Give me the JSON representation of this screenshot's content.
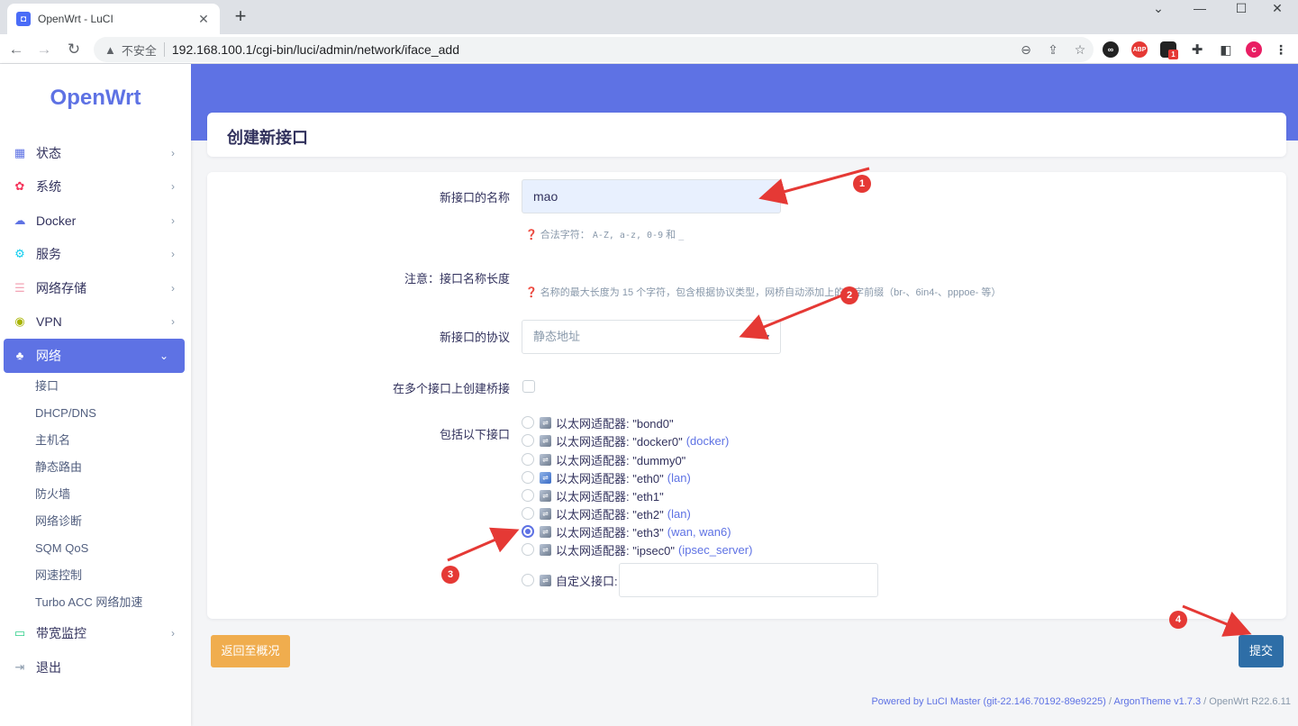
{
  "browser": {
    "tab_title": "OpenWrt - LuCI",
    "tab_close": "✕",
    "new_tab": "+",
    "not_secure": "不安全",
    "url": "192.168.100.1/cgi-bin/luci/admin/network/iface_add",
    "profile_initial": "c",
    "ext_badge": "1",
    "ext_abp": "ABP"
  },
  "sidebar": {
    "logo": "OpenWrt",
    "menu": [
      {
        "label": "状态",
        "icon": "dashboard-icon"
      },
      {
        "label": "系统",
        "icon": "gear-icon"
      },
      {
        "label": "Docker",
        "icon": "docker-icon"
      },
      {
        "label": "服务",
        "icon": "services-icon"
      },
      {
        "label": "网络存储",
        "icon": "storage-icon"
      },
      {
        "label": "VPN",
        "icon": "vpn-icon"
      },
      {
        "label": "网络",
        "icon": "network-icon"
      }
    ],
    "network_sub": [
      "接口",
      "DHCP/DNS",
      "主机名",
      "静态路由",
      "防火墙",
      "网络诊断",
      "SQM QoS",
      "网速控制",
      "Turbo ACC 网络加速"
    ],
    "after": [
      {
        "label": "带宽监控",
        "icon": "monitor-icon"
      },
      {
        "label": "退出",
        "icon": "logout-icon"
      }
    ]
  },
  "page": {
    "title": "创建新接口"
  },
  "form": {
    "name_label": "新接口的名称",
    "name_value": "mao",
    "name_hint_prefix": "合法字符：",
    "name_hint_chars": "A-Z, a-z, 0-9",
    "name_hint_and": "和",
    "name_hint_underscore": "_",
    "note_label": "注意：接口名称长度",
    "note_hint": "名称的最大长度为 15 个字符，包含根据协议类型，网桥自动添加上的名字前缀（br-、6in4-、pppoe- 等）",
    "protocol_label": "新接口的协议",
    "protocol_value": "静态地址",
    "bridge_label": "在多个接口上创建桥接",
    "include_label": "包括以下接口",
    "interfaces": [
      {
        "text": "以太网适配器: \"bond0\"",
        "zone": ""
      },
      {
        "text": "以太网适配器: \"docker0\"",
        "zone": "(docker)"
      },
      {
        "text": "以太网适配器: \"dummy0\"",
        "zone": ""
      },
      {
        "text": "以太网适配器: \"eth0\"",
        "zone": "(lan)"
      },
      {
        "text": "以太网适配器: \"eth1\"",
        "zone": ""
      },
      {
        "text": "以太网适配器: \"eth2\"",
        "zone": "(lan)"
      },
      {
        "text": "以太网适配器: \"eth3\"",
        "zone": "(wan, wan6)"
      },
      {
        "text": "以太网适配器: \"ipsec0\"",
        "zone": "(ipsec_server)"
      }
    ],
    "selected_interface": "eth3",
    "custom_label": "自定义接口:",
    "back_button": "返回至概况",
    "submit_button": "提交"
  },
  "footer": {
    "powered": "Powered by LuCI Master (git-22.146.70192-89e9225)",
    "slash1": " / ",
    "theme": "ArgonTheme v1.7.3",
    "slash2": " / ",
    "version": "OpenWrt R22.6.11"
  },
  "annotations": [
    "1",
    "2",
    "3",
    "4"
  ],
  "colors": {
    "accent": "#5e72e4",
    "warning": "#f0ad4e",
    "primary_btn": "#2e6ea7",
    "annotation": "#e53935"
  }
}
